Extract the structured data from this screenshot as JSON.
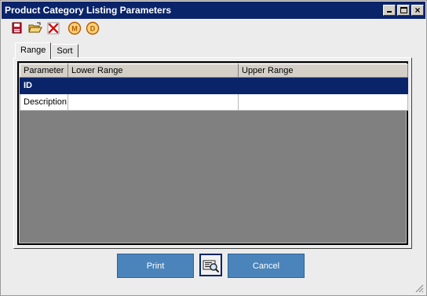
{
  "window": {
    "title": "Product Category Listing Parameters"
  },
  "toolbar": {
    "icons": [
      "save-icon",
      "open-folder-icon",
      "delete-icon",
      "m-icon",
      "d-icon"
    ],
    "m_letter": "M",
    "d_letter": "D"
  },
  "tabs": [
    {
      "label": "Range",
      "active": true
    },
    {
      "label": "Sort",
      "active": false
    }
  ],
  "grid": {
    "columns": [
      "Parameter",
      "Lower Range",
      "Upper Range"
    ],
    "rows": [
      {
        "parameter": "ID",
        "lower": "",
        "upper": "",
        "selected": true
      },
      {
        "parameter": "Description",
        "lower": "",
        "upper": "",
        "selected": false
      }
    ]
  },
  "buttons": {
    "print": "Print",
    "cancel": "Cancel"
  },
  "colors": {
    "title_bar": "#0a246a",
    "selected_row": "#0a246a",
    "button_blue": "#4a84bb",
    "grid_background": "#808080"
  }
}
